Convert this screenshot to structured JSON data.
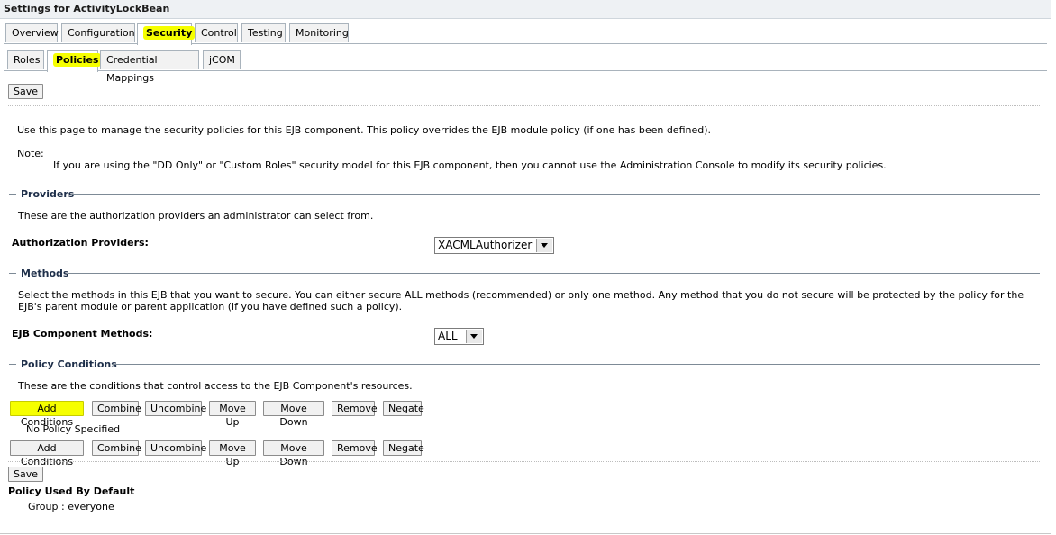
{
  "window": {
    "title": "Settings for ActivityLockBean"
  },
  "main_tabs": [
    "Overview",
    "Configuration",
    "Security",
    "Control",
    "Testing",
    "Monitoring"
  ],
  "sub_tabs": [
    "Roles",
    "Policies",
    "Credential Mappings",
    "jCOM"
  ],
  "toolbar": {
    "save_label": "Save"
  },
  "intro": {
    "description": "Use this page to manage the security policies for this EJB component. This policy overrides the EJB module policy (if one has been defined).",
    "note_label": "Note:",
    "note_text": "If you are using the \"DD Only\" or \"Custom Roles\" security model for this EJB component, then you cannot use the Administration Console to modify its security policies."
  },
  "providers": {
    "heading": "Providers",
    "description": "These are the authorization providers an administrator can select from.",
    "field_label": "Authorization Providers:",
    "selected": "XACMLAuthorizer"
  },
  "methods": {
    "heading": "Methods",
    "description": "Select the methods in this EJB that you want to secure. You can either secure ALL methods (recommended) or only one method. Any method that you do not secure will be protected by the policy for the EJB's parent module or parent application (if you have defined such a policy).",
    "field_label": "EJB Component Methods:",
    "selected": "ALL"
  },
  "policy_conditions": {
    "heading": "Policy Conditions",
    "description": "These are the conditions that control access to the EJB Component's resources.",
    "buttons": [
      "Add Conditions",
      "Combine",
      "Uncombine",
      "Move Up",
      "Move Down",
      "Remove",
      "Negate"
    ],
    "empty_text": "No Policy Specified"
  },
  "default_policy": {
    "heading": "Policy Used By Default",
    "value": "Group : everyone"
  },
  "colors": {
    "highlight": "#f6ff00",
    "section_heading": "#1e2f4a",
    "rule": "#7d8a96"
  }
}
